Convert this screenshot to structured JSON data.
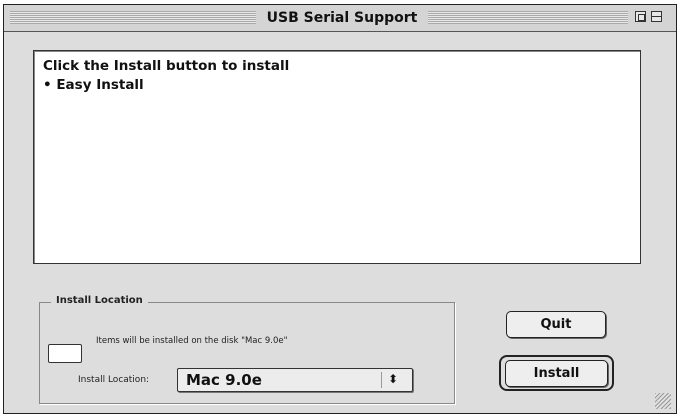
{
  "window": {
    "title": "USB Serial Support"
  },
  "message": {
    "line1": "Click the Install button to install",
    "line2": "• Easy Install"
  },
  "install_location": {
    "group_title": "Install Location",
    "disk_text": "Items will be installed on the disk \"Mac 9.0e\"",
    "label": "Install Location:",
    "selected": "Mac 9.0e",
    "arrow": "⬍"
  },
  "buttons": {
    "quit": "Quit",
    "install": "Install"
  },
  "icons": [
    "zoom-box-icon",
    "collapse-box-icon",
    "disk-icon",
    "popup-arrow-icon",
    "grow-box-icon"
  ]
}
